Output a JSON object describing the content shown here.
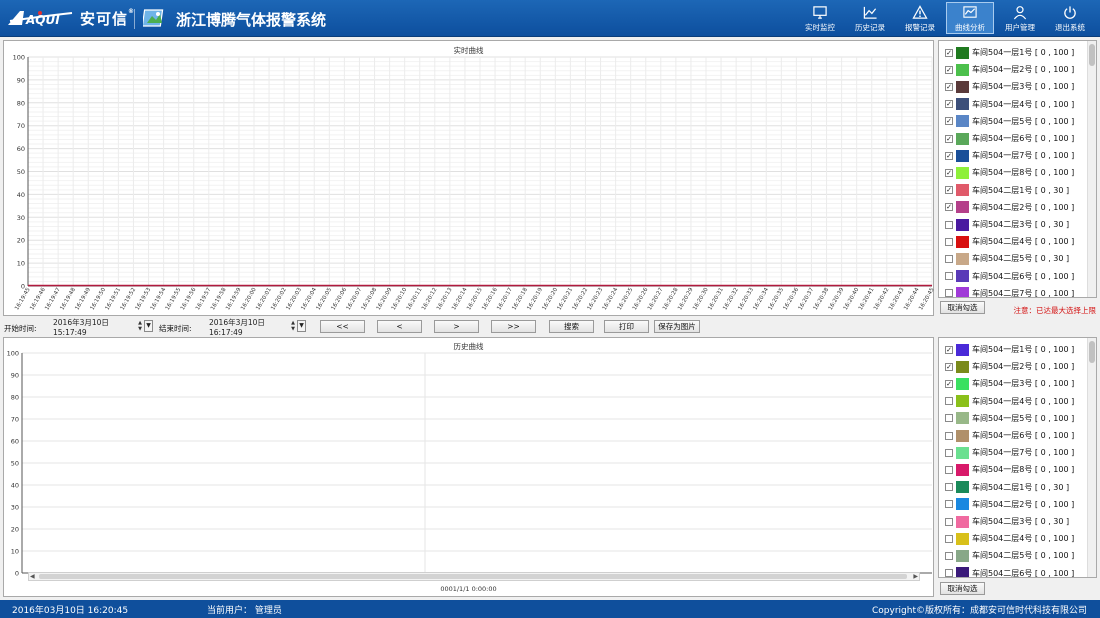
{
  "header": {
    "brand_name": "安可信",
    "brand_reg": "®",
    "logo_text": "AQUI",
    "system_title": "浙江博腾气体报警系统",
    "nav": [
      {
        "label": "实时监控",
        "icon": "monitor-icon",
        "active": false
      },
      {
        "label": "历史记录",
        "icon": "chart-line-icon",
        "active": false
      },
      {
        "label": "报警记录",
        "icon": "warning-icon",
        "active": false
      },
      {
        "label": "曲线分析",
        "icon": "curve-icon",
        "active": true
      },
      {
        "label": "用户管理",
        "icon": "user-icon",
        "active": false
      },
      {
        "label": "退出系统",
        "icon": "power-icon",
        "active": false
      }
    ]
  },
  "realtime": {
    "title": "实时曲线",
    "line_color": "#b11a3e",
    "legend": [
      {
        "label": "车间504一层1号 [ 0 , 100 ]",
        "color": "#1f7a1f",
        "checked": true
      },
      {
        "label": "车间504一层2号 [ 0 , 100 ]",
        "color": "#4cc04c",
        "checked": true
      },
      {
        "label": "车间504一层3号 [ 0 , 100 ]",
        "color": "#5a3a3a",
        "checked": true
      },
      {
        "label": "车间504一层4号 [ 0 , 100 ]",
        "color": "#3c4f7a",
        "checked": true
      },
      {
        "label": "车间504一层5号 [ 0 , 100 ]",
        "color": "#5a86c6",
        "checked": true
      },
      {
        "label": "车间504一层6号 [ 0 , 100 ]",
        "color": "#5aa85a",
        "checked": true
      },
      {
        "label": "车间504一层7号 [ 0 , 100 ]",
        "color": "#1a4f99",
        "checked": true
      },
      {
        "label": "车间504一层8号 [ 0 , 100 ]",
        "color": "#8ef03a",
        "checked": true
      },
      {
        "label": "车间504二层1号 [ 0 , 30 ]",
        "color": "#e05a6a",
        "checked": true
      },
      {
        "label": "车间504二层2号 [ 0 , 100 ]",
        "color": "#b4408a",
        "checked": true
      },
      {
        "label": "车间504二层3号 [ 0 , 30 ]",
        "color": "#4a1aa0",
        "checked": false
      },
      {
        "label": "车间504二层4号 [ 0 , 100 ]",
        "color": "#d81010",
        "checked": false
      },
      {
        "label": "车间504二层5号 [ 0 , 30 ]",
        "color": "#c8a888",
        "checked": false
      },
      {
        "label": "车间504二层6号 [ 0 , 100 ]",
        "color": "#5a3ab8",
        "checked": false
      },
      {
        "label": "车间504二层7号 [ 0 , 100 ]",
        "color": "#a03ad8",
        "checked": false
      }
    ],
    "clear_button": "取消勾选",
    "notice": "注意：已达最大选择上限"
  },
  "toolbar": {
    "start_label": "开始时间:",
    "start_value": "2016年3月10日 15:17:49",
    "end_label": "结束时间:",
    "end_value": "2016年3月10日 16:17:49",
    "buttons": [
      "<<",
      "<",
      ">",
      ">>",
      "搜索",
      "打印",
      "保存为图片"
    ]
  },
  "history": {
    "title": "历史曲线",
    "x_label": "0001/1/1 0:00:00",
    "legend": [
      {
        "label": "车间504一层1号 [ 0 , 100 ]",
        "color": "#4a2ad8",
        "checked": true
      },
      {
        "label": "车间504一层2号 [ 0 , 100 ]",
        "color": "#7a8a1a",
        "checked": true
      },
      {
        "label": "车间504一层3号 [ 0 , 100 ]",
        "color": "#3ae060",
        "checked": true
      },
      {
        "label": "车间504一层4号 [ 0 , 100 ]",
        "color": "#8ac01a",
        "checked": false
      },
      {
        "label": "车间504一层5号 [ 0 , 100 ]",
        "color": "#98b888",
        "checked": false
      },
      {
        "label": "车间504一层6号 [ 0 , 100 ]",
        "color": "#b0906a",
        "checked": false
      },
      {
        "label": "车间504一层7号 [ 0 , 100 ]",
        "color": "#6ae090",
        "checked": false
      },
      {
        "label": "车间504一层8号 [ 0 , 100 ]",
        "color": "#d81a6a",
        "checked": false
      },
      {
        "label": "车间504二层1号 [ 0 , 30 ]",
        "color": "#1a8a5a",
        "checked": false
      },
      {
        "label": "车间504二层2号 [ 0 , 100 ]",
        "color": "#1a88e0",
        "checked": false
      },
      {
        "label": "车间504二层3号 [ 0 , 30 ]",
        "color": "#f06aa0",
        "checked": false
      },
      {
        "label": "车间504二层4号 [ 0 , 100 ]",
        "color": "#d8c01a",
        "checked": false
      },
      {
        "label": "车间504二层5号 [ 0 , 100 ]",
        "color": "#88a888",
        "checked": false
      },
      {
        "label": "车间504二层6号 [ 0 , 100 ]",
        "color": "#3a1a7a",
        "checked": false
      }
    ],
    "clear_button": "取消勾选"
  },
  "chart_data": [
    {
      "type": "line",
      "title": "实时曲线",
      "ylim": [
        0,
        100
      ],
      "yticks": [
        0,
        10,
        20,
        30,
        40,
        50,
        60,
        70,
        80,
        90,
        100
      ],
      "x": [
        "16:19:45",
        "16:19:46",
        "16:19:47",
        "16:19:48",
        "16:19:49",
        "16:19:50",
        "16:19:51",
        "16:19:52",
        "16:19:53",
        "16:19:54",
        "16:19:55",
        "16:19:56",
        "16:19:57",
        "16:19:58",
        "16:19:59",
        "16:20:00",
        "16:20:01",
        "16:20:02",
        "16:20:03",
        "16:20:04",
        "16:20:05",
        "16:20:06",
        "16:20:07",
        "16:20:08",
        "16:20:09",
        "16:20:10",
        "16:20:11",
        "16:20:12",
        "16:20:13",
        "16:20:14",
        "16:20:15",
        "16:20:16",
        "16:20:17",
        "16:20:18",
        "16:20:19",
        "16:20:20",
        "16:20:21",
        "16:20:22",
        "16:20:23",
        "16:20:24",
        "16:20:25",
        "16:20:26",
        "16:20:27",
        "16:20:28",
        "16:20:29",
        "16:20:30",
        "16:20:31",
        "16:20:32",
        "16:20:33",
        "16:20:34",
        "16:20:35",
        "16:20:36",
        "16:20:37",
        "16:20:38",
        "16:20:39",
        "16:20:40",
        "16:20:41",
        "16:20:42",
        "16:20:43",
        "16:20:44",
        "16:20:45"
      ],
      "values": 0,
      "grid": true
    },
    {
      "type": "line",
      "title": "历史曲线",
      "ylim": [
        0,
        100
      ],
      "yticks": [
        0,
        10,
        20,
        30,
        40,
        50,
        60,
        70,
        80,
        90,
        100
      ],
      "x": [
        "0001/1/1 0:00:00"
      ],
      "grid": true
    }
  ],
  "status": {
    "datetime": "2016年03月10日 16:20:45",
    "user_label": "当前用户：",
    "user_name": "管理员",
    "copyright": "Copyright©版权所有：成都安可信时代科技有限公司"
  }
}
